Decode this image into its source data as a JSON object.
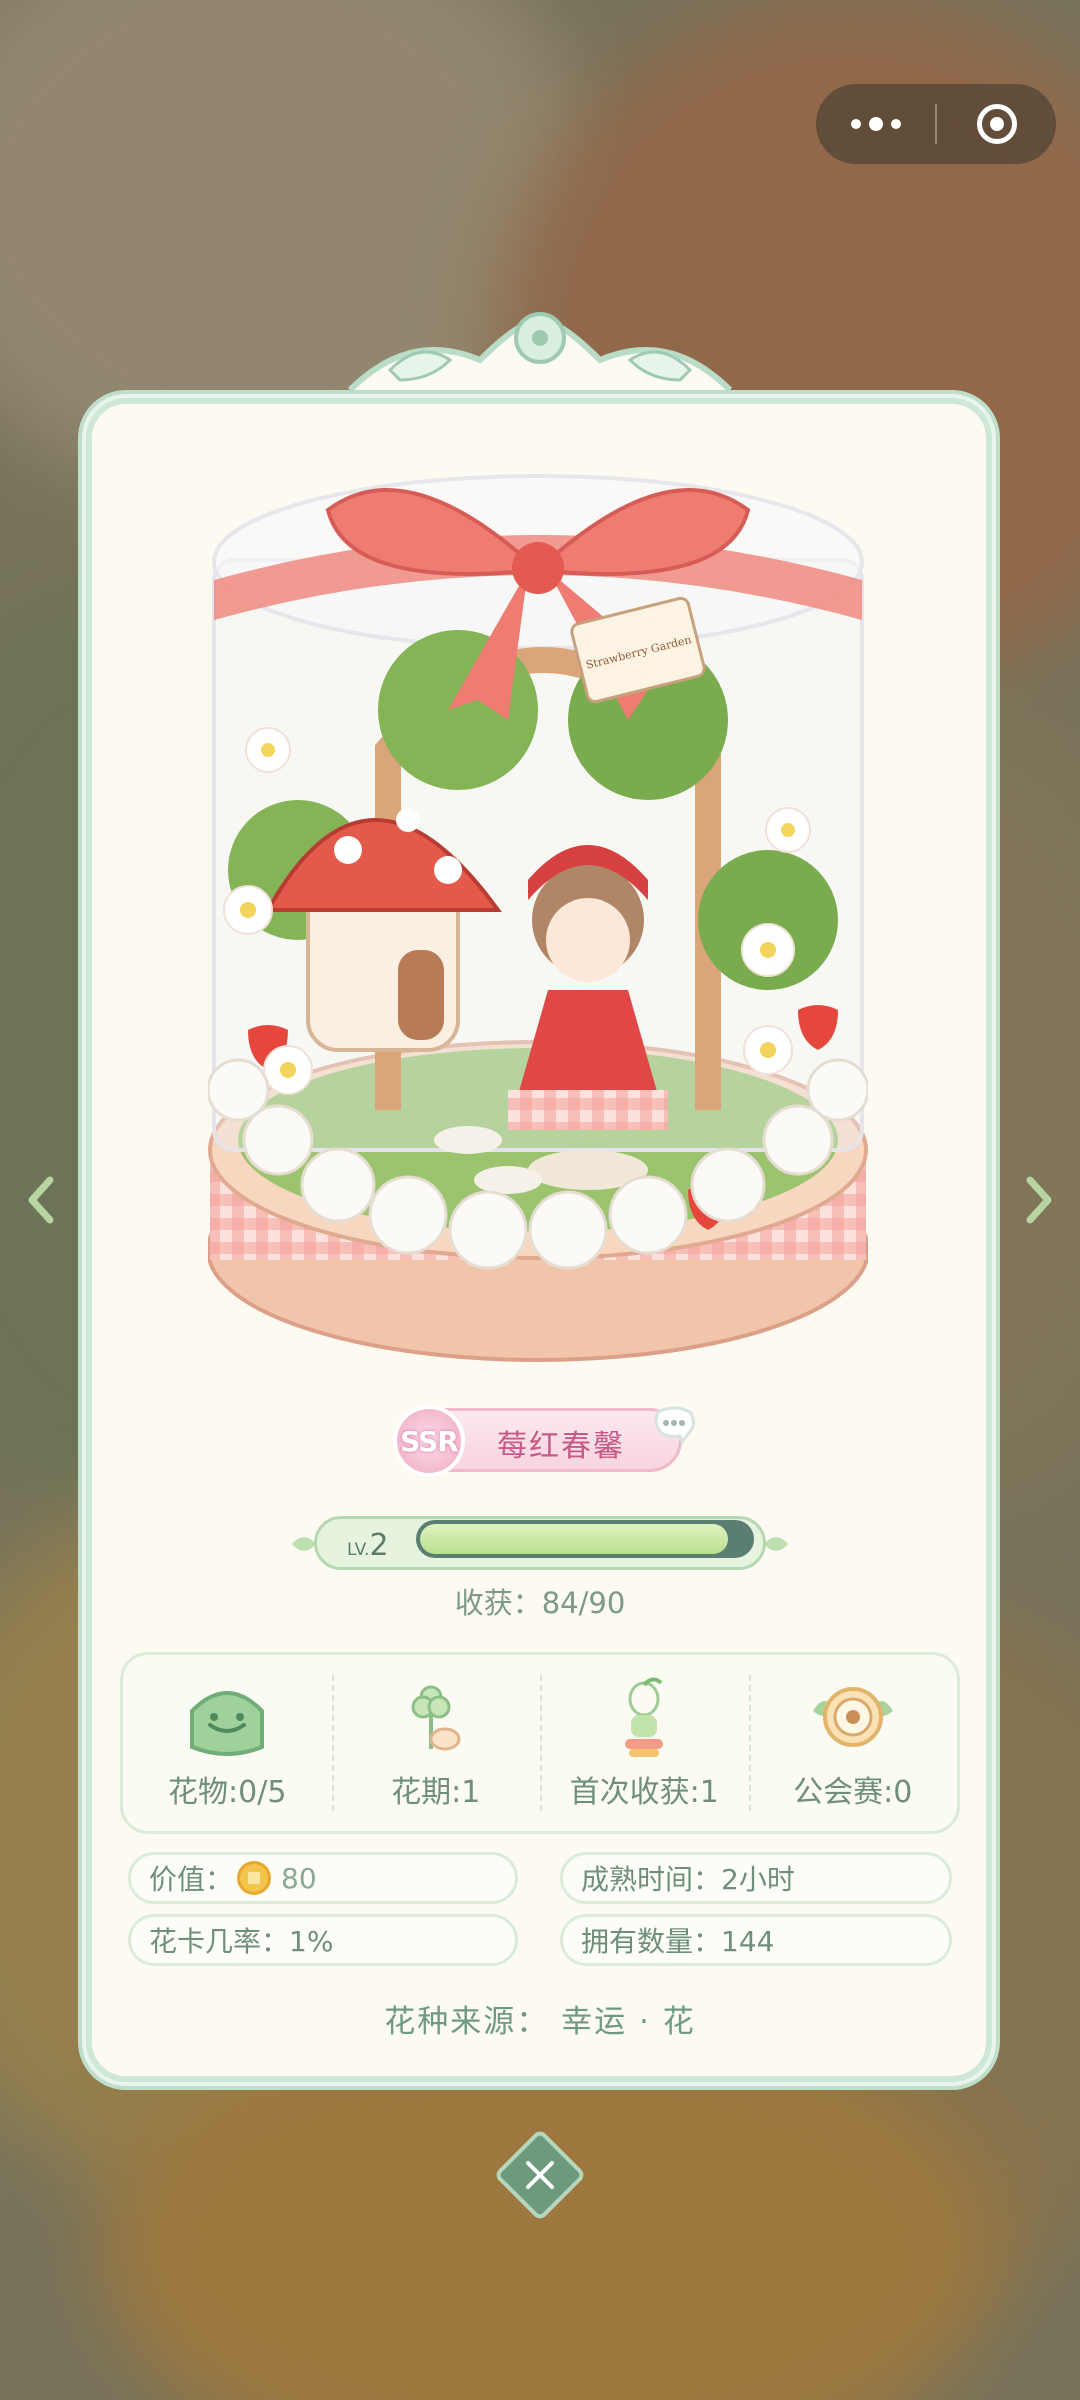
{
  "window": {
    "menu_icon": "more-dots-icon",
    "close_icon": "target-circle-icon"
  },
  "navigation": {
    "prev_icon": "chevron-left-icon",
    "next_icon": "chevron-right-icon"
  },
  "flower": {
    "rarity": "SSR",
    "name": "莓红春馨",
    "illustration_sign": "Strawberry Garden",
    "level_prefix": "LV.",
    "level": "2",
    "harvest": "收获：84/90",
    "harvest_progress": 0.9333
  },
  "stats": [
    {
      "label": "花物:0/5",
      "icon": "flower-pot-icon"
    },
    {
      "label": "花期:1",
      "icon": "flower-bud-icon"
    },
    {
      "label": "首次收获:1",
      "icon": "sprout-character-icon"
    },
    {
      "label": "公会赛:0",
      "icon": "guild-emblem-icon"
    }
  ],
  "info": {
    "value_label": "价值：",
    "value_amount": "80",
    "maturity": "成熟时间：2小时",
    "card_rate": "花卡几率：1%",
    "owned": "拥有数量：144"
  },
  "source": "花种来源：  幸运 · 花",
  "colors": {
    "accent_green": "#6d9a80",
    "pink": "#c65a86",
    "card_bg": "#fdfaf2"
  }
}
